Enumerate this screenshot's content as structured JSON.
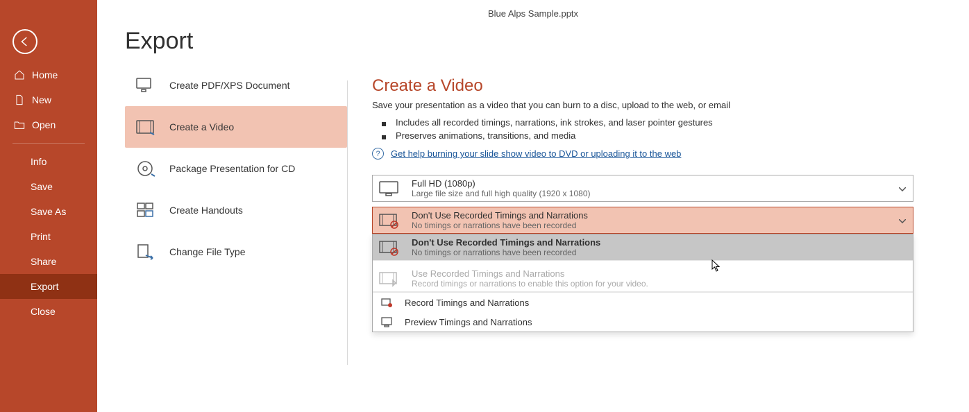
{
  "window": {
    "title": "Blue Alps Sample.pptx"
  },
  "sidebar": {
    "nav1": [
      {
        "label": "Home"
      },
      {
        "label": "New"
      },
      {
        "label": "Open"
      }
    ],
    "nav2": [
      {
        "label": "Info"
      },
      {
        "label": "Save"
      },
      {
        "label": "Save As"
      },
      {
        "label": "Print"
      },
      {
        "label": "Share"
      },
      {
        "label": "Export"
      },
      {
        "label": "Close"
      }
    ]
  },
  "export": {
    "title": "Export",
    "options": [
      {
        "label": "Create PDF/XPS Document"
      },
      {
        "label": "Create a Video"
      },
      {
        "label": "Package Presentation for CD"
      },
      {
        "label": "Create Handouts"
      },
      {
        "label": "Change File Type"
      }
    ]
  },
  "detail": {
    "title": "Create a Video",
    "subtitle": "Save your presentation as a video that you can burn to a disc, upload to the web, or email",
    "bullets": [
      "Includes all recorded timings, narrations, ink strokes, and laser pointer gestures",
      "Preserves animations, transitions, and media"
    ],
    "help_link": "Get help burning your slide show video to DVD or uploading it to the web",
    "quality": {
      "title": "Full HD (1080p)",
      "desc": "Large file size and full high quality (1920 x 1080)"
    },
    "timings_selected": {
      "title": "Don't Use Recorded Timings and Narrations",
      "desc": "No timings or narrations have been recorded"
    },
    "timings_popup": {
      "opt1": {
        "title": "Don't Use Recorded Timings and Narrations",
        "desc": "No timings or narrations have been recorded"
      },
      "opt2": {
        "title": "Use Recorded Timings and Narrations",
        "desc": "Record timings or narrations to enable this option for your video."
      },
      "action1": "Record Timings and Narrations",
      "action2": "Preview Timings and Narrations"
    }
  }
}
